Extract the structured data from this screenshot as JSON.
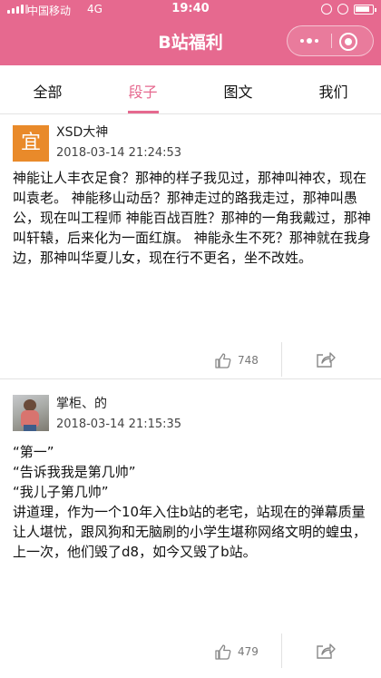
{
  "status_bar": {
    "carrier": "中国移动",
    "network": "4G",
    "time": "19:40"
  },
  "header": {
    "title": "B站福利",
    "bg_color": "#e6698f"
  },
  "tabs": [
    {
      "label": "全部",
      "active": false
    },
    {
      "label": "段子",
      "active": true
    },
    {
      "label": "图文",
      "active": false
    },
    {
      "label": "我们",
      "active": false
    }
  ],
  "posts": [
    {
      "avatar_text": "宜",
      "username": "XSD大神",
      "datetime": "2018-03-14 21:24:53",
      "content": "神能让人丰衣足食？那神的样子我见过，那神叫神农，现在叫袁老。 神能移山动岳？那神走过的路我走过，那神叫愚公，现在叫工程师 神能百战百胜？那神的一角我戴过，那神叫轩辕，后来化为一面红旗。 神能永生不死？那神就在我身边，那神叫华夏儿女，现在行不更名，坐不改姓。",
      "likes": "748"
    },
    {
      "username": "掌柜、的",
      "datetime": "2018-03-14 21:15:35",
      "content": "“第一”\n“告诉我我是第几帅”\n“我儿子第几帅”\n讲道理，作为一个10年入住b站的老宅，站现在的弹幕质量让人堪忧，跟风狗和无脑刷的小学生堪称网络文明的蝗虫，上一次，他们毁了d8，如今又毁了b站。",
      "likes": "479"
    }
  ],
  "icons": {
    "like": "thumbs-up-icon",
    "share": "share-icon"
  }
}
